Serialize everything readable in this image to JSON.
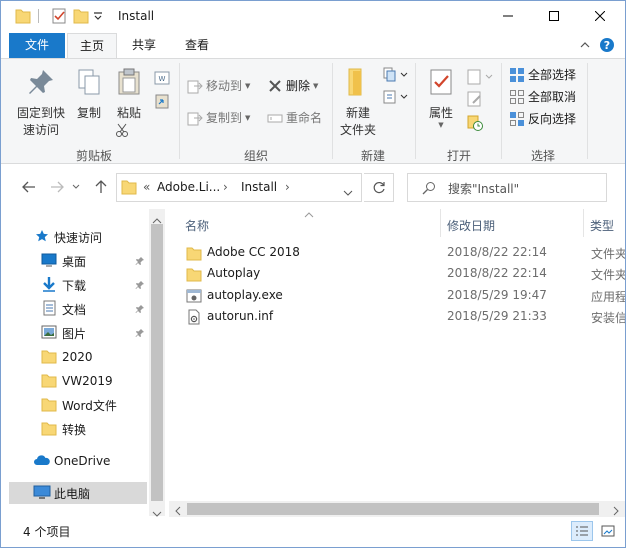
{
  "window": {
    "title": "Install",
    "minimize_glyph": "—",
    "maximize_glyph": "☐",
    "close_glyph": "✕"
  },
  "tabs": [
    {
      "label": "文件",
      "active": false
    },
    {
      "label": "主页",
      "active": true
    },
    {
      "label": "共享",
      "active": false
    },
    {
      "label": "查看",
      "active": false
    }
  ],
  "ribbon": {
    "clipboard": {
      "pin_label_1": "固定到快",
      "pin_label_2": "速访问",
      "copy": "复制",
      "paste": "粘贴",
      "group": "剪贴板"
    },
    "organize": {
      "move_to": "移动到",
      "delete": "删除",
      "copy_to": "复制到",
      "rename": "重命名",
      "group": "组织"
    },
    "new": {
      "new_folder_1": "新建",
      "new_folder_2": "文件夹",
      "group": "新建"
    },
    "open": {
      "properties": "属性",
      "group": "打开"
    },
    "select": {
      "select_all": "全部选择",
      "select_none": "全部取消",
      "invert": "反向选择",
      "group": "选择"
    }
  },
  "address": {
    "prefix": "«",
    "crumbs": [
      "Adobe.Li...",
      "Install"
    ],
    "search_placeholder": "搜索\"Install\""
  },
  "nav_pane": {
    "quick_access": "快速访问",
    "items": [
      {
        "label": "桌面",
        "icon": "desktop-icon",
        "pinned": true
      },
      {
        "label": "下载",
        "icon": "download-icon",
        "pinned": true
      },
      {
        "label": "文档",
        "icon": "documents-icon",
        "pinned": true
      },
      {
        "label": "图片",
        "icon": "pictures-icon",
        "pinned": true
      },
      {
        "label": "2020",
        "icon": "folder-icon",
        "pinned": false
      },
      {
        "label": "VW2019",
        "icon": "folder-icon",
        "pinned": false
      },
      {
        "label": "Word文件",
        "icon": "folder-icon",
        "pinned": false
      },
      {
        "label": "转换",
        "icon": "folder-icon",
        "pinned": false
      }
    ],
    "onedrive": "OneDrive",
    "this_pc": "此电脑"
  },
  "columns": {
    "name": "名称",
    "date": "修改日期",
    "type": "类型"
  },
  "files": [
    {
      "name": "Adobe CC 2018",
      "date": "2018/8/22 22:14",
      "type": "文件夹",
      "icon": "folder-icon"
    },
    {
      "name": "Autoplay",
      "date": "2018/8/22 22:14",
      "type": "文件夹",
      "icon": "folder-icon"
    },
    {
      "name": "autoplay.exe",
      "date": "2018/5/29 19:47",
      "type": "应用程序",
      "icon": "exe-icon"
    },
    {
      "name": "autorun.inf",
      "date": "2018/5/29 21:33",
      "type": "安装信息",
      "icon": "inf-icon"
    }
  ],
  "status": {
    "count": "4 个项目"
  },
  "colors": {
    "accent": "#1979ca",
    "folder": "#f8d775",
    "folder_dark": "#e0b94a",
    "selected": "#d9d9d9"
  }
}
